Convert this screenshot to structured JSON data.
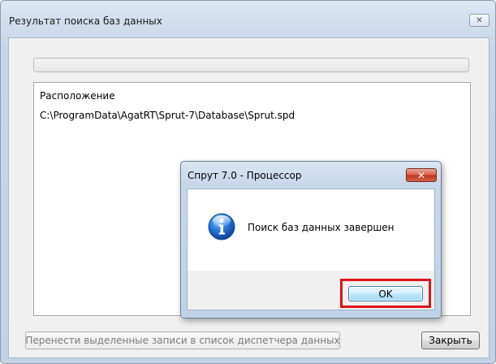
{
  "main_window": {
    "title": "Результат поиска баз данных",
    "close_glyph": "✕",
    "list": {
      "column_header": "Расположение",
      "rows": [
        "C:\\ProgramData\\AgatRT\\Sprut-7\\Database\\Sprut.spd"
      ]
    },
    "move_button_label": "Перенести выделенные записи в список диспетчера данных",
    "close_button_label": "Закрыть"
  },
  "message_box": {
    "title": "Спрут 7.0 - Процессор",
    "close_glyph": "✕",
    "icon": "info-icon",
    "message": "Поиск баз данных завершен",
    "ok_label": "OK",
    "highlight_color": "#e0121c"
  }
}
